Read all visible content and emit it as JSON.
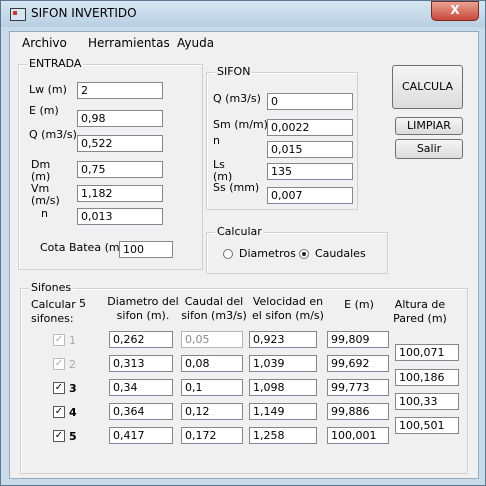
{
  "window": {
    "title": "SIFON INVERTIDO",
    "close": "X"
  },
  "menu": [
    "Archivo",
    "Herramientas",
    "Ayuda"
  ],
  "entrada": {
    "legend": "ENTRADA",
    "fields": [
      {
        "label": "Lw (m)",
        "value": "2"
      },
      {
        "label": "E (m)",
        "value": "0,98"
      },
      {
        "label": "Q (m3/s)",
        "value": "0,522"
      },
      {
        "label": "Dm (m)",
        "value": "0,75"
      },
      {
        "label": "Vm (m/s)",
        "value": "1,182"
      },
      {
        "label": "n",
        "value": "0,013"
      }
    ],
    "cota_label": "Cota Batea (m)",
    "cota_value": "100"
  },
  "sifon": {
    "legend": "SIFON",
    "fields": [
      {
        "label": "Q (m3/s)",
        "value": "0"
      },
      {
        "label": "Sm (m/m)",
        "value": "0,0022"
      },
      {
        "label": "n",
        "value": "0,015"
      },
      {
        "label": "Ls (m)",
        "value": "135"
      },
      {
        "label": "Ss (mm)",
        "value": "0,007"
      }
    ]
  },
  "buttons": {
    "calcula": "CALCULA",
    "limpiar": "LIMPIAR",
    "salir": "Salir"
  },
  "calcular": {
    "legend": "Calcular",
    "options": [
      {
        "label": "Diametros",
        "checked": false
      },
      {
        "label": "Caudales",
        "checked": true
      }
    ]
  },
  "sifones": {
    "legend": "Sifones",
    "calc_label": "Calcular sifones:",
    "calc_value": "5",
    "headers": {
      "diametro": "Diametro del sifon (m).",
      "caudal": "Caudal del sifon (m3/s)",
      "velocidad": "Velocidad en el sifon (m/s)",
      "e": "E (m)",
      "altura": "Altura de Pared (m)"
    },
    "rows": [
      {
        "num": "1",
        "enabled": false,
        "diametro": "0,262",
        "caudal": "0,05",
        "caudal_disabled": true,
        "velocidad": "0,923",
        "e": "99,809"
      },
      {
        "num": "2",
        "enabled": false,
        "diametro": "0,313",
        "caudal": "0,08",
        "caudal_disabled": false,
        "velocidad": "1,039",
        "e": "99,692"
      },
      {
        "num": "3",
        "enabled": true,
        "diametro": "0,34",
        "caudal": "0,1",
        "caudal_disabled": false,
        "velocidad": "1,098",
        "e": "99,773"
      },
      {
        "num": "4",
        "enabled": true,
        "diametro": "0,364",
        "caudal": "0,12",
        "caudal_disabled": false,
        "velocidad": "1,149",
        "e": "99,886"
      },
      {
        "num": "5",
        "enabled": true,
        "diametro": "0,417",
        "caudal": "0,172",
        "caudal_disabled": false,
        "velocidad": "1,258",
        "e": "100,001"
      }
    ],
    "alturas": [
      "100,071",
      "100,186",
      "100,33",
      "100,501"
    ]
  }
}
